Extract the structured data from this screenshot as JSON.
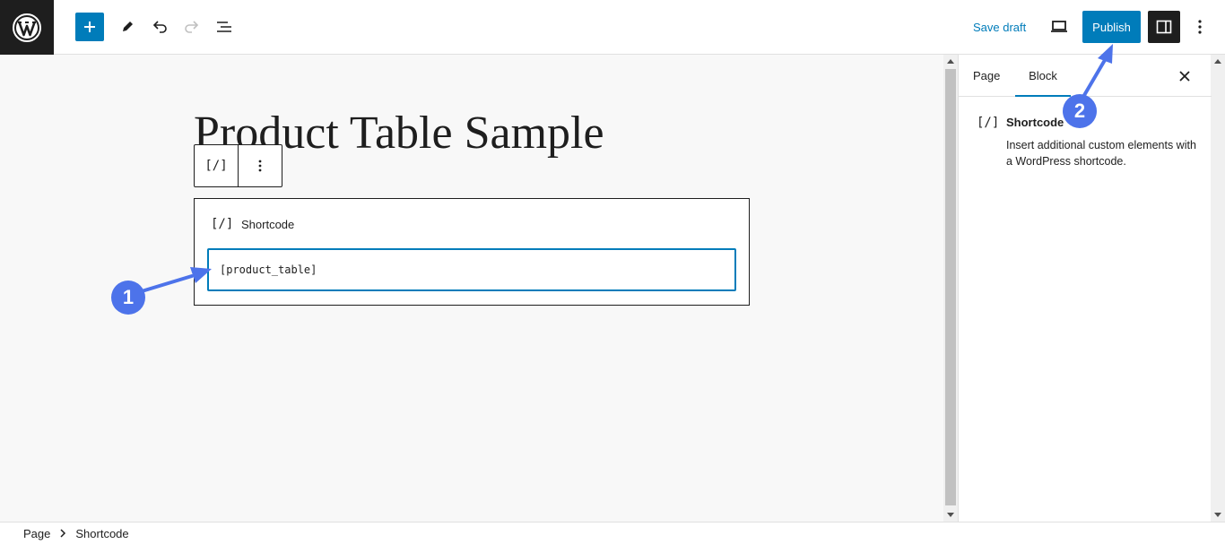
{
  "header": {
    "logo": "wordpress-logo",
    "tools": [
      "add-block",
      "tools-pencil",
      "undo",
      "redo",
      "document-overview"
    ],
    "save_draft": "Save draft",
    "preview": "desktop-preview",
    "publish": "Publish",
    "settings": "settings-panel-toggle",
    "more": "more-options"
  },
  "canvas": {
    "title": "Product Table Sample",
    "toolbar": {
      "block_icon": "[/]",
      "options": "⋮"
    },
    "block": {
      "icon": "[/]",
      "label": "Shortcode",
      "value": "[product_table]"
    }
  },
  "sidebar": {
    "tabs": [
      "Page",
      "Block"
    ],
    "active_tab": "Block",
    "block_icon": "[/]",
    "block_title": "Shortcode",
    "block_description": "Insert additional custom elements with a WordPress shortcode."
  },
  "footer": {
    "breadcrumb": [
      "Page",
      "Shortcode"
    ]
  },
  "annotations": [
    "1",
    "2"
  ],
  "colors": {
    "accent": "#007cba",
    "annotation": "#4d73ea",
    "dark": "#1e1e1e",
    "canvas_bg": "#f8f8f8"
  }
}
